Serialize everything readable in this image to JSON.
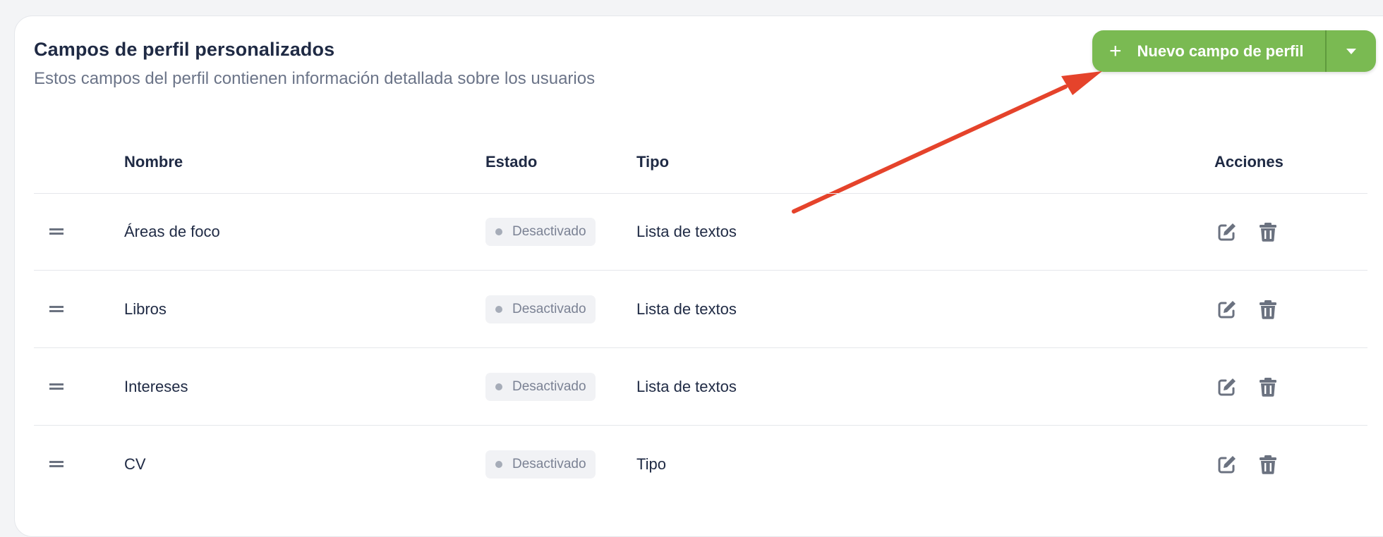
{
  "header": {
    "title": "Campos de perfil personalizados",
    "subtitle": "Estos campos del perfil contienen información detallada sobre los usuarios"
  },
  "actions": {
    "new_field_label": "Nuevo campo de perfil",
    "plus_icon": "+",
    "dropdown_icon": "chevron-down-icon"
  },
  "colors": {
    "primary_button": "#7aba52",
    "annotation_arrow": "#e5432b"
  },
  "table": {
    "columns": {
      "name": "Nombre",
      "status": "Estado",
      "type": "Tipo",
      "actions": "Acciones"
    },
    "rows": [
      {
        "name": "Áreas de foco",
        "status": "Desactivado",
        "type": "Lista de textos"
      },
      {
        "name": "Libros",
        "status": "Desactivado",
        "type": "Lista de textos"
      },
      {
        "name": "Intereses",
        "status": "Desactivado",
        "type": "Lista de textos"
      },
      {
        "name": "CV",
        "status": "Desactivado",
        "type": "Tipo"
      }
    ]
  }
}
